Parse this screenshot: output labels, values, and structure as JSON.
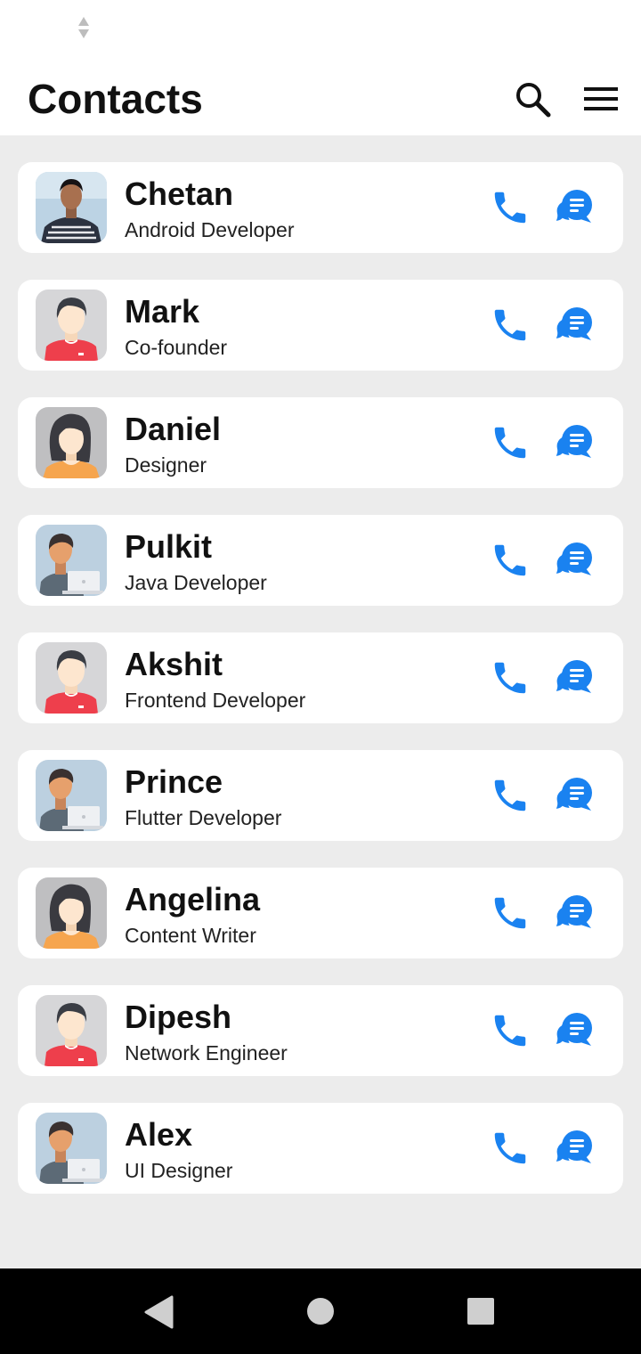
{
  "app": {
    "title": "Contacts"
  },
  "header": {
    "search_icon": "search-icon",
    "menu_icon": "menu-icon"
  },
  "colors": {
    "accent": "#1a82f0",
    "background": "#ececec",
    "card": "#ffffff",
    "nav_bar": "#000000"
  },
  "contacts": [
    {
      "name": "Chetan",
      "role": "Android Developer",
      "avatar": "photo"
    },
    {
      "name": "Mark",
      "role": "Co-founder",
      "avatar": "male"
    },
    {
      "name": "Daniel",
      "role": "Designer",
      "avatar": "female"
    },
    {
      "name": "Pulkit",
      "role": "Java Developer",
      "avatar": "laptop"
    },
    {
      "name": "Akshit",
      "role": "Frontend Developer",
      "avatar": "male"
    },
    {
      "name": "Prince",
      "role": "Flutter Developer",
      "avatar": "laptop"
    },
    {
      "name": "Angelina",
      "role": "Content Writer",
      "avatar": "female"
    },
    {
      "name": "Dipesh",
      "role": "Network Engineer",
      "avatar": "male"
    },
    {
      "name": "Alex",
      "role": "UI Designer",
      "avatar": "laptop"
    }
  ],
  "row_actions": {
    "call_icon": "phone-icon",
    "message_icon": "chat-icon"
  },
  "nav": {
    "back_icon": "back-triangle-icon",
    "home_icon": "home-circle-icon",
    "recents_icon": "recents-square-icon"
  }
}
